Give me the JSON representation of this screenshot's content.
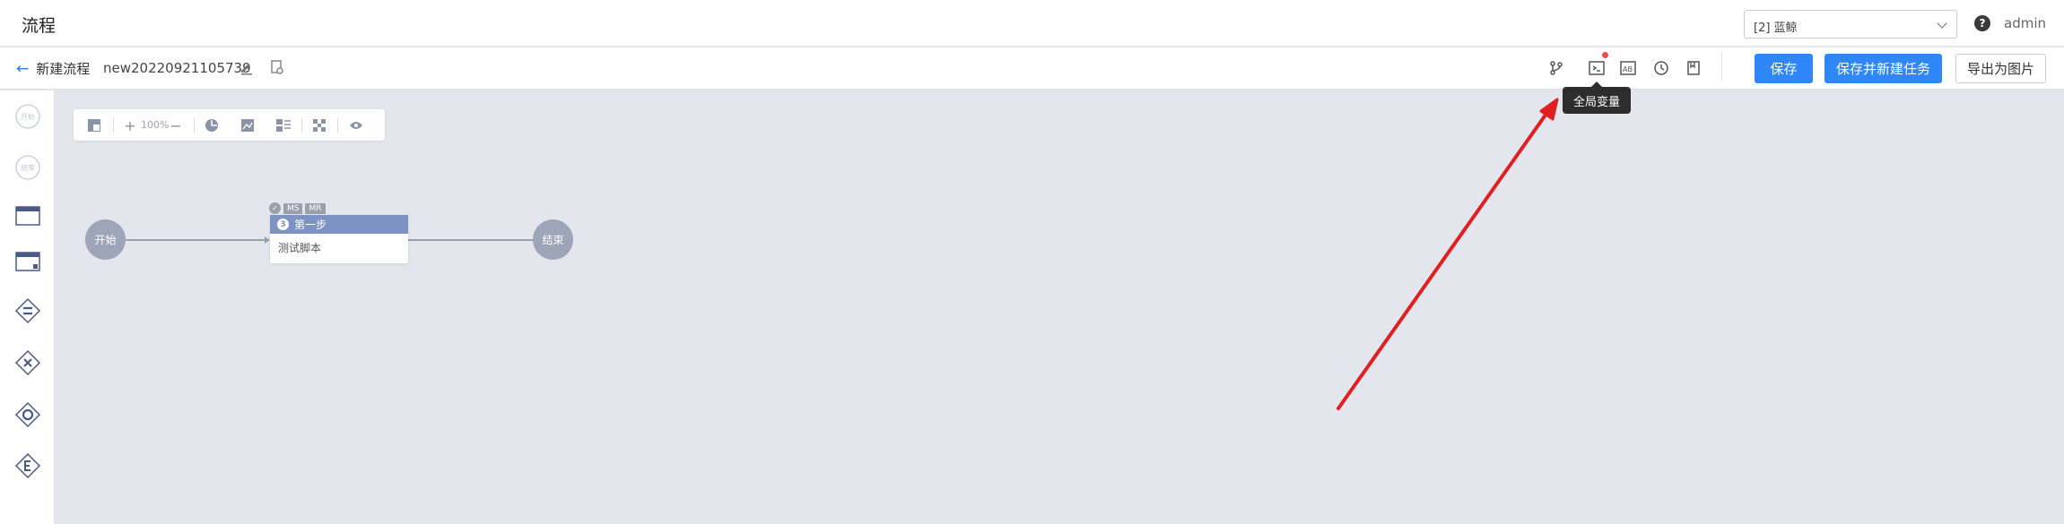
{
  "header": {
    "app_title": "流程",
    "project_select_value": "[2] 蓝鲸",
    "help_icon": "question-circle-icon",
    "username": "admin"
  },
  "subbar": {
    "back_label": "新建流程",
    "flow_name": "new20220921105739",
    "icons": [
      "branch-icon",
      "global-variable-icon",
      "ab-icon",
      "history-icon",
      "bookmark-icon"
    ],
    "buttons": {
      "save": "保存",
      "save_and_new_task": "保存并新建任务",
      "export_image": "导出为图片"
    },
    "tooltip": "全局变量"
  },
  "palette": {
    "items": [
      {
        "name": "start",
        "label": "开始"
      },
      {
        "name": "end",
        "label": "结束"
      },
      {
        "name": "task-node"
      },
      {
        "name": "subprocess-node"
      },
      {
        "name": "parallel-gateway"
      },
      {
        "name": "exclusive-gateway"
      },
      {
        "name": "converge-gateway"
      },
      {
        "name": "conditional-parallel-gateway"
      }
    ]
  },
  "canvas_toolbar": {
    "zoom": "100%"
  },
  "canvas": {
    "start_label": "开始",
    "end_label": "结束",
    "step": {
      "number": "3",
      "title": "第一步",
      "body": "测试脚本",
      "badges": [
        "MS",
        "MR"
      ]
    }
  },
  "colors": {
    "primary": "#2f86f6",
    "node": "#9fa5b8",
    "step_header": "#7f93c2",
    "annotation": "#e02020"
  }
}
